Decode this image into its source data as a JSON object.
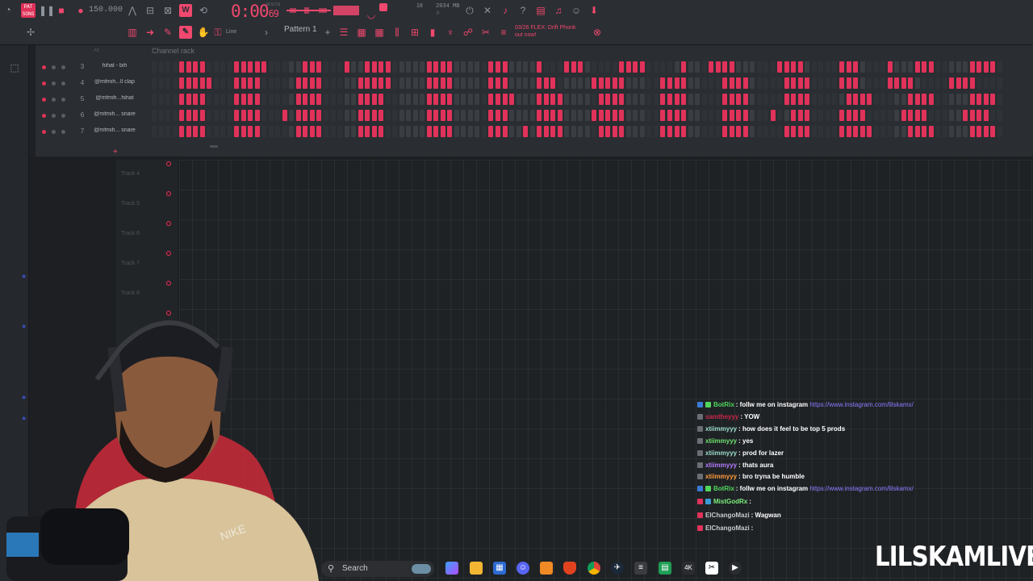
{
  "toolbar": {
    "song_badge": "PAT SONG",
    "bpm": "150.000",
    "time": "0:00",
    "time_ticks": "69",
    "time_mode": "M:S:CS",
    "cpu_count": "18",
    "memory": "2034 MB",
    "memory_sub": "0",
    "pattern": "Pattern 1",
    "snap_mode": "Line",
    "news_line1": "03/26 FLEX: Drift Phonk",
    "news_line2": "out now!"
  },
  "channel_rack": {
    "title": "Channel rack",
    "filter": "All",
    "colors": {
      "active": "#e0325a",
      "accent": "#ee8fa4",
      "inactive": "#3a3d42",
      "alt": "#2f3236"
    },
    "channels": [
      {
        "number": "3",
        "name": "hihat - bih",
        "pattern": "0000111100001111100000111000100111100000111100000111000010001110000011110000010001111000000111100000111000010001110000011110"
      },
      {
        "number": "4",
        "name": "@mfmih...ll clap",
        "pattern": "0000111110001111000001111000001111100000111100000111000011100000111110000011110000011110000011110000111000011110000011110000"
      },
      {
        "number": "5",
        "name": "@mfmih...hihat",
        "pattern": "0000111100001111000001111000001111000000111100000111100011110000011110000011110000011110000011110000011110000011110000011110"
      },
      {
        "number": "6",
        "name": "@mfmih... snare",
        "pattern": "0000111100001111000101111000001111000000111100000111000011110000111110000011110000011110001001110000111100000111100000111100"
      },
      {
        "number": "7",
        "name": "@mfmih... snare",
        "pattern": "0000111100001111000001111000001111000000111100000111001011110000011110000011110000011110000011110000111110000011110000011110"
      }
    ]
  },
  "playlist": {
    "tracks": [
      "Track 4",
      "Track 5",
      "Track 6",
      "Track 7",
      "Track 8"
    ]
  },
  "chat": {
    "messages": [
      {
        "user": "BotRix",
        "text": ": follw me on instagram",
        "link": "https://www.instagram.com/lilskamx/",
        "color": "#4fd65b",
        "badges": [
          "#3a7bd5",
          "#4fd65b"
        ]
      },
      {
        "user": "samtheyyy",
        "text": ": YOW",
        "link": "",
        "color": "#c8274b",
        "badges": [
          "#6b6f75"
        ]
      },
      {
        "user": "xtiimmyyy",
        "text": ": how does it feel to be top 5 prods",
        "link": "",
        "color": "#9bdbc8",
        "badges": [
          "#6b6f75"
        ]
      },
      {
        "user": "xtiimmyyy",
        "text": ": yes",
        "link": "",
        "color": "#6ee06e",
        "badges": [
          "#6b6f75"
        ]
      },
      {
        "user": "xtiimmyyy",
        "text": ": prod for lazer",
        "link": "",
        "color": "#9bdbc8",
        "badges": [
          "#6b6f75"
        ]
      },
      {
        "user": "xtiimmyyy",
        "text": ": thats aura",
        "link": "",
        "color": "#b57cff",
        "badges": [
          "#6b6f75"
        ]
      },
      {
        "user": "xtiimmyyy",
        "text": ": bro tryna be humble",
        "link": "",
        "color": "#ff9a3c",
        "badges": [
          "#6b6f75"
        ]
      },
      {
        "user": "BotRix",
        "text": ": follw me on instagram",
        "link": "https://www.instagram.com/lilskamx/",
        "color": "#4fd65b",
        "badges": [
          "#3a7bd5",
          "#4fd65b"
        ]
      },
      {
        "user": "MistGodRx",
        "text": ":",
        "link": "",
        "color": "#7df07d",
        "badges": [
          "#e0325a",
          "#3a9bd5"
        ]
      },
      {
        "user": "ElChangoMazi",
        "text": ": Wagwan",
        "link": "",
        "color": "#c9ccd1",
        "badges": [
          "#e0325a"
        ]
      },
      {
        "user": "ElChangoMazi",
        "text": ":",
        "link": "",
        "color": "#c9ccd1",
        "badges": [
          "#e0325a"
        ]
      }
    ]
  },
  "taskbar": {
    "search_label": "Search",
    "icons": [
      "search-icon",
      "copilot-icon",
      "file-explorer-icon",
      "store-icon",
      "discord-icon",
      "fl-studio-icon",
      "brave-icon",
      "chrome-icon",
      "steam-icon",
      "app-icon",
      "sheets-icon",
      "4k-icon",
      "capcut-icon",
      "play-icon"
    ]
  },
  "stream": {
    "watermark": "LILSKAMLIVE"
  }
}
